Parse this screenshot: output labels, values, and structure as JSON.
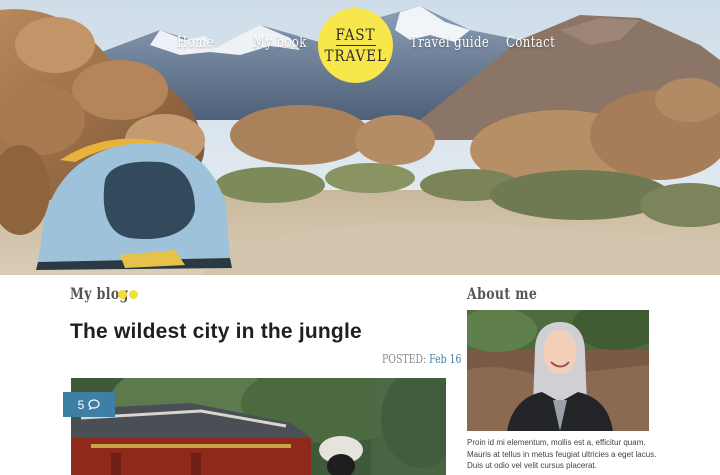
{
  "nav": {
    "items": [
      {
        "label": "Home"
      },
      {
        "label": "My book"
      },
      {
        "label": "Travel guide"
      },
      {
        "label": "Contact"
      }
    ],
    "logo": {
      "line1": "FAST",
      "line2": "TRAVEL"
    }
  },
  "blog": {
    "section_title": "My blog",
    "post": {
      "title": "The wildest city in the jungle",
      "posted_label": "POSTED:",
      "posted_date": "Feb 16",
      "comments": "5"
    }
  },
  "sidebar": {
    "title": "About me",
    "text": "Proin id mi elementum, mollis est a, efficitur quam. Mauris at tellus in metus feugiat ultricies a eget lacus. Duis ut odio vel velit cursus placerat."
  },
  "colors": {
    "accent": "#f7e74a",
    "link": "#3e7fa6"
  },
  "icons": {
    "comment": "speech-bubble-icon"
  }
}
